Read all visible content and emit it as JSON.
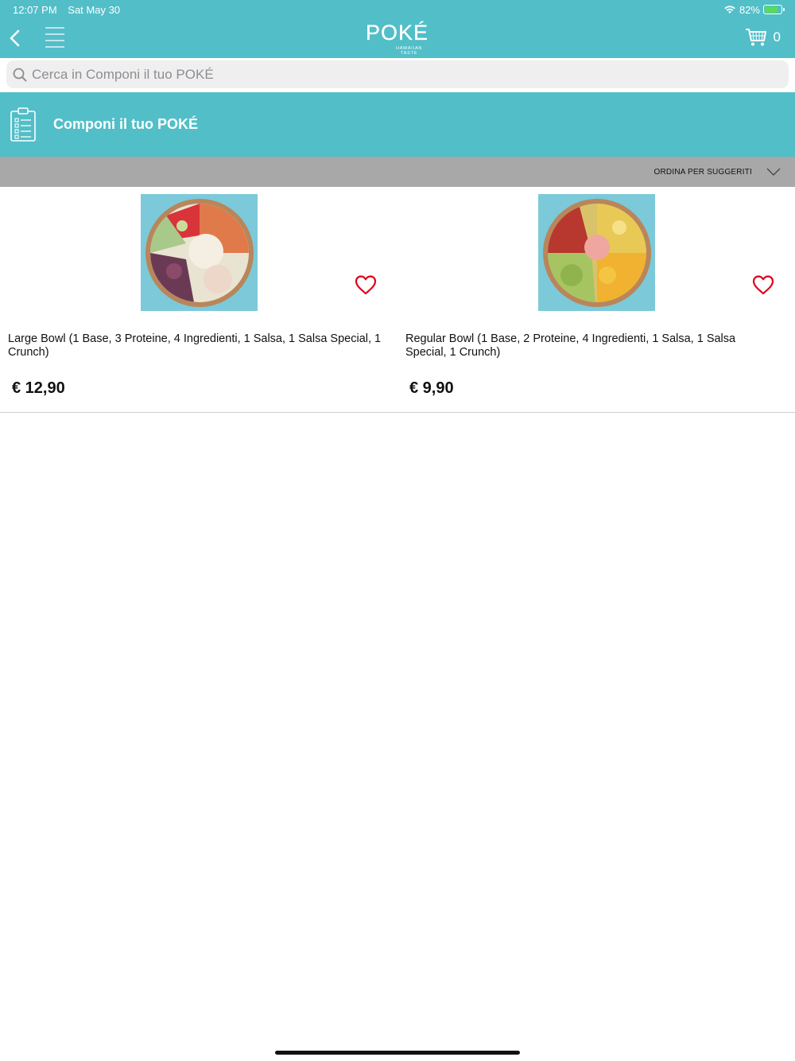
{
  "status_bar": {
    "time": "12:07 PM",
    "date": "Sat May 30",
    "battery": "82%",
    "battery_level": 0.82
  },
  "header": {
    "brand": "POKÉ",
    "brand_tagline_1": "HAWAIIAN",
    "brand_tagline_2": "TASTE",
    "cart_count": "0",
    "icons": [
      "chevron-left-icon",
      "hamburger-menu-icon",
      "cart-icon"
    ]
  },
  "search": {
    "placeholder": "Cerca in Componi il tuo POKÉ",
    "value": ""
  },
  "category": {
    "title": "Componi il tuo POKÉ",
    "icon": "clipboard-checklist-icon"
  },
  "sort": {
    "label": "ORDINA PER SUGGERITI",
    "icon": "chevron-down-icon"
  },
  "products": [
    {
      "name": "Large Bowl (1 Base, 3 Proteine, 4 Ingredienti, 1 Salsa, 1 Salsa Special, 1 Crunch)",
      "price": "€ 12,90",
      "favorite": false
    },
    {
      "name": "Regular Bowl (1 Base, 2 Proteine, 4 Ingredienti, 1 Salsa, 1 Salsa Special, 1 Crunch)",
      "price": "€ 9,90",
      "favorite": false
    }
  ],
  "colors": {
    "accent": "#52bec8",
    "sort_bar": "#a8a8a8",
    "favorite_heart": "#e3001b",
    "battery_fill": "#5bd95b"
  }
}
